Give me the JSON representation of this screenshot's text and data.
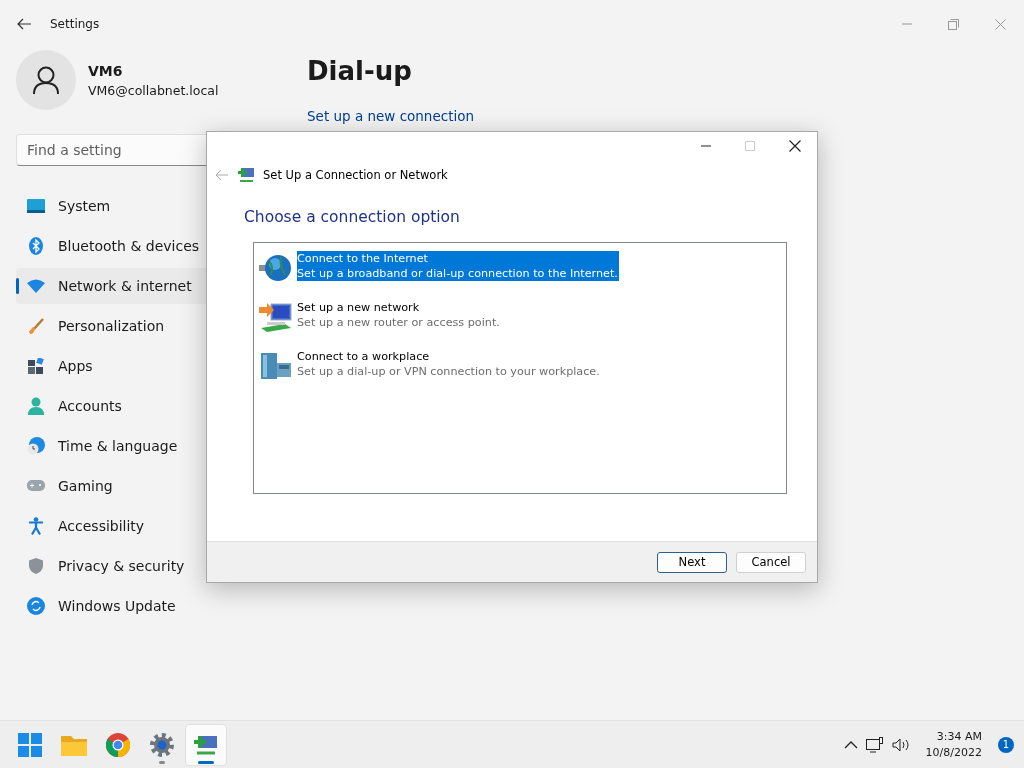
{
  "settings_window": {
    "title": "Settings",
    "user": {
      "name": "VM6",
      "email": "VM6@collabnet.local"
    },
    "search": {
      "placeholder": "Find a setting"
    },
    "sidebar": {
      "items": [
        {
          "label": "System",
          "selected": false
        },
        {
          "label": "Bluetooth & devices",
          "selected": false
        },
        {
          "label": "Network & internet",
          "selected": true
        },
        {
          "label": "Personalization",
          "selected": false
        },
        {
          "label": "Apps",
          "selected": false
        },
        {
          "label": "Accounts",
          "selected": false
        },
        {
          "label": "Time & language",
          "selected": false
        },
        {
          "label": "Gaming",
          "selected": false
        },
        {
          "label": "Accessibility",
          "selected": false
        },
        {
          "label": "Privacy & security",
          "selected": false
        },
        {
          "label": "Windows Update",
          "selected": false
        }
      ]
    },
    "page": {
      "title": "Dial-up",
      "link": "Set up a new connection"
    }
  },
  "dialog": {
    "title": "Set Up a Connection or Network",
    "heading": "Choose a connection option",
    "options": [
      {
        "title": "Connect to the Internet",
        "description": "Set up a broadband or dial-up connection to the Internet.",
        "selected": true
      },
      {
        "title": "Set up a new network",
        "description": "Set up a new router or access point.",
        "selected": false
      },
      {
        "title": "Connect to a workplace",
        "description": "Set up a dial-up or VPN connection to your workplace.",
        "selected": false
      }
    ],
    "buttons": [
      {
        "label": "Next",
        "default": true
      },
      {
        "label": "Cancel",
        "default": false
      }
    ]
  },
  "taskbar": {
    "apps": [
      {
        "kind": "start",
        "running": false,
        "selected": false
      },
      {
        "kind": "folder",
        "running": false,
        "selected": false
      },
      {
        "kind": "chrome",
        "running": false,
        "selected": false
      },
      {
        "kind": "settings",
        "running": true,
        "selected": false
      },
      {
        "kind": "network",
        "running": true,
        "selected": true
      }
    ],
    "clock": {
      "time": "3:34 AM",
      "date": "10/8/2022"
    },
    "notifications": "1"
  }
}
